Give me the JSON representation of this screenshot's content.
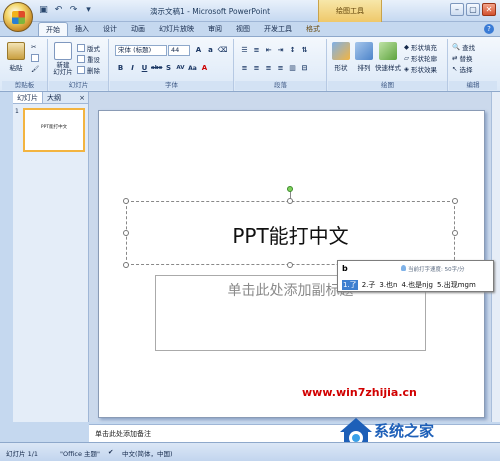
{
  "window": {
    "title": "演示文稿1 - Microsoft PowerPoint",
    "context_tool": "绘图工具"
  },
  "quick_access": [
    "save-icon",
    "undo-icon",
    "redo-icon",
    "customize-icon"
  ],
  "tabs": [
    "开始",
    "插入",
    "设计",
    "动画",
    "幻灯片放映",
    "审阅",
    "视图",
    "开发工具",
    "格式"
  ],
  "ribbon": {
    "clipboard": {
      "label": "剪贴板",
      "paste": "粘贴"
    },
    "slides": {
      "label": "幻灯片",
      "new_slide": "新建\n幻灯片",
      "layout": "版式",
      "reset": "重设",
      "delete": "删除"
    },
    "font": {
      "label": "字体",
      "font_name": "宋体 (标题)",
      "font_size": "44",
      "buttons": [
        "B",
        "I",
        "U",
        "abe",
        "S",
        "AV",
        "Aa",
        "A"
      ]
    },
    "paragraph": {
      "label": "段落"
    },
    "drawing": {
      "label": "绘图",
      "shapes": "形状",
      "arrange": "排列",
      "quick_styles": "快速样式",
      "fill": "形状填充",
      "outline": "形状轮廓",
      "effects": "形状效果"
    },
    "editing": {
      "label": "编辑",
      "find": "查找",
      "replace": "替换",
      "select": "选择"
    }
  },
  "panel": {
    "tab_slides": "幻灯片",
    "tab_outline": "大纲",
    "close": "×",
    "thumb_number": "1",
    "thumb_text": "PPT能打中文"
  },
  "slide": {
    "title": "PPT能打中文",
    "subtitle_placeholder": "单击此处添加副标题"
  },
  "ime": {
    "input": "b",
    "speed": "当前打字速度: 50字/分",
    "candidates": [
      "1.了",
      "2.子",
      "3.也n",
      "4.也是njg",
      "5.出现mgm"
    ]
  },
  "notes": {
    "placeholder": "单击此处添加备注"
  },
  "status": {
    "slide": "幻灯片 1/1",
    "theme": "\"Office 主题\"",
    "lang": "中文(简体，中国)"
  },
  "watermark": {
    "url": "www.win7zhijia.cn",
    "brand": "系统之家"
  },
  "colors": {
    "ribbon_bg": "#dbe8f7",
    "accent": "#3d7fd0",
    "context_tab": "#efc86a",
    "watermark_red": "#d10000"
  }
}
